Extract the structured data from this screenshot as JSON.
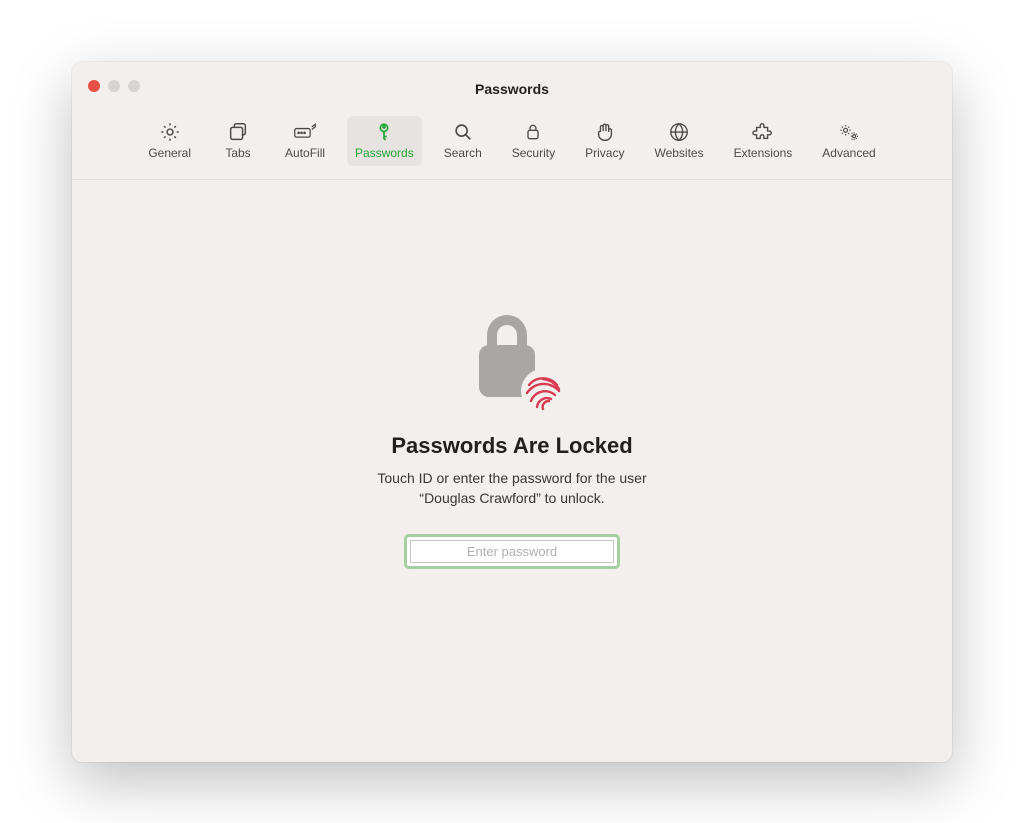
{
  "window": {
    "title": "Passwords"
  },
  "toolbar": {
    "tabs": [
      {
        "id": "general",
        "label": "General",
        "icon": "gear-icon"
      },
      {
        "id": "tabs",
        "label": "Tabs",
        "icon": "tabs-icon"
      },
      {
        "id": "autofill",
        "label": "AutoFill",
        "icon": "autofill-icon"
      },
      {
        "id": "passwords",
        "label": "Passwords",
        "icon": "key-icon",
        "active": true
      },
      {
        "id": "search",
        "label": "Search",
        "icon": "magnifier-icon"
      },
      {
        "id": "security",
        "label": "Security",
        "icon": "lock-icon"
      },
      {
        "id": "privacy",
        "label": "Privacy",
        "icon": "hand-icon"
      },
      {
        "id": "websites",
        "label": "Websites",
        "icon": "globe-icon"
      },
      {
        "id": "extensions",
        "label": "Extensions",
        "icon": "puzzle-icon"
      },
      {
        "id": "advanced",
        "label": "Advanced",
        "icon": "gears-icon"
      }
    ]
  },
  "main": {
    "heading": "Passwords Are Locked",
    "subtext_line1": "Touch ID or enter the password for the user",
    "subtext_line2": "“Douglas Crawford” to unlock.",
    "password_placeholder": "Enter password",
    "password_value": ""
  },
  "colors": {
    "accent": "#20a730",
    "fingerprint": "#d83b52",
    "lock": "#a9a6a4"
  }
}
